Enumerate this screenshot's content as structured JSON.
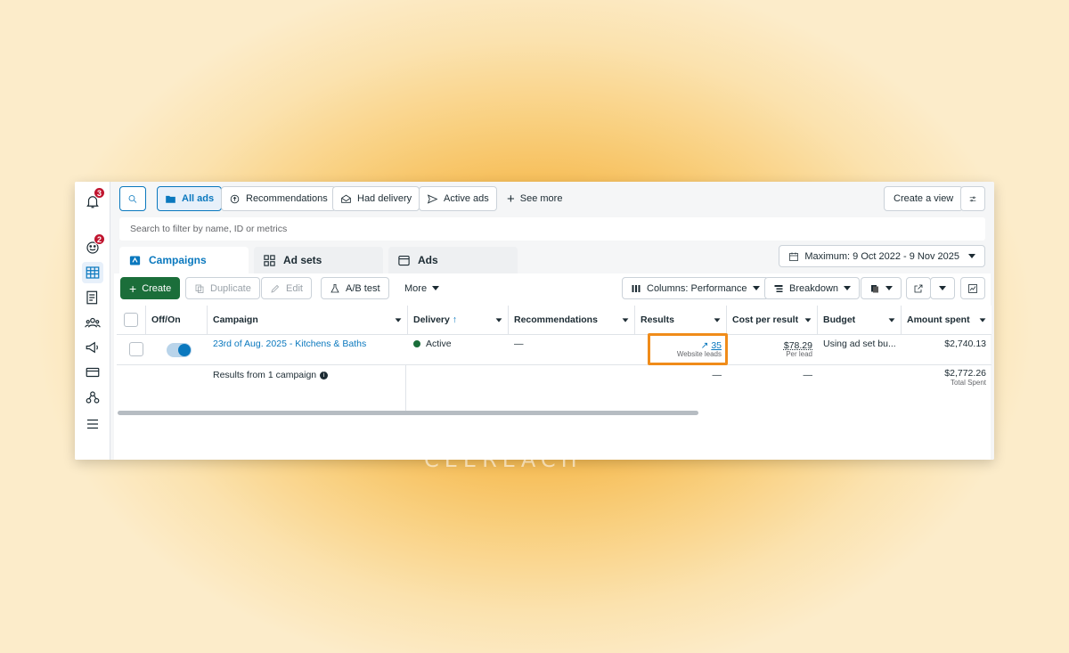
{
  "rail": {
    "notifications_badge": "3",
    "account_badge": "2"
  },
  "toolbar": {
    "filters": [
      "All ads",
      "Recommendations",
      "Had delivery",
      "Active ads"
    ],
    "see_more": "See more",
    "create_view": "Create a view",
    "search_placeholder": "Search to filter by name, ID or metrics"
  },
  "tabs": {
    "campaigns": "Campaigns",
    "adsets": "Ad sets",
    "ads": "Ads"
  },
  "date_range": "Maximum: 9 Oct 2022 - 9 Nov 2025",
  "actions": {
    "create": "Create",
    "duplicate": "Duplicate",
    "edit": "Edit",
    "ab_test": "A/B test",
    "more": "More",
    "columns": "Columns: Performance",
    "breakdown": "Breakdown"
  },
  "table": {
    "headers": [
      "Off/On",
      "Campaign",
      "Delivery",
      "Recommendations",
      "Results",
      "Cost per result",
      "Budget",
      "Amount spent"
    ],
    "row": {
      "campaign": "23rd of Aug. 2025 - Kitchens & Baths",
      "delivery": "Active",
      "recommendations": "—",
      "results_value": "35",
      "results_label": "Website leads",
      "cost_value": "$78.29",
      "cost_label": "Per lead",
      "budget": "Using ad set bu...",
      "amount_spent": "$2,740.13"
    },
    "summary": {
      "label": "Results from 1 campaign",
      "results": "—",
      "cost": "—",
      "amount": "$2,772.26",
      "amount_label": "Total Spent"
    }
  },
  "watermark": "CEEREACH",
  "colors": {
    "accent": "#0a78be",
    "create_green": "#1b6e3a",
    "highlight": "#f08c1a"
  }
}
